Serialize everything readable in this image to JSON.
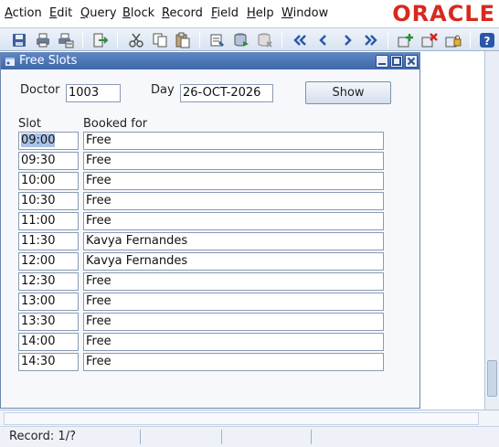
{
  "menu": {
    "items": [
      {
        "label": "Action",
        "mnemonic": "A",
        "rest": "ction"
      },
      {
        "label": "Edit",
        "mnemonic": "E",
        "rest": "dit"
      },
      {
        "label": "Query",
        "mnemonic": "Q",
        "rest": "uery"
      },
      {
        "label": "Block",
        "mnemonic": "B",
        "rest": "lock"
      },
      {
        "label": "Record",
        "mnemonic": "R",
        "rest": "ecord"
      },
      {
        "label": "Field",
        "mnemonic": "F",
        "rest": "ield"
      },
      {
        "label": "Help",
        "mnemonic": "H",
        "rest": "elp"
      },
      {
        "label": "Window",
        "mnemonic": "W",
        "rest": "indow"
      }
    ],
    "brand": "ORACLE",
    "brand_color": "#d7291e"
  },
  "toolbar": {
    "icons": [
      "save-icon",
      "print-icon",
      "print-setup-icon",
      "exit-icon",
      "cut-icon",
      "copy-icon",
      "paste-icon",
      "enter-query-icon",
      "execute-query-icon",
      "cancel-query-icon",
      "first-record-icon",
      "previous-record-icon",
      "next-record-icon",
      "last-record-icon",
      "insert-record-icon",
      "delete-record-icon",
      "lock-record-icon",
      "help-icon"
    ]
  },
  "window": {
    "title": "Free Slots",
    "title_color": "#4a74b6"
  },
  "form": {
    "doctor_label": "Doctor",
    "doctor_value": "1003",
    "day_label": "Day",
    "day_value": "26-OCT-2026",
    "show_label": "Show"
  },
  "table": {
    "headers": {
      "slot": "Slot",
      "booked_for": "Booked for"
    },
    "rows": [
      {
        "slot": "09:00",
        "booked_for": "Free"
      },
      {
        "slot": "09:30",
        "booked_for": "Free"
      },
      {
        "slot": "10:00",
        "booked_for": "Free"
      },
      {
        "slot": "10:30",
        "booked_for": "Free"
      },
      {
        "slot": "11:00",
        "booked_for": "Free"
      },
      {
        "slot": "11:30",
        "booked_for": "Kavya Fernandes"
      },
      {
        "slot": "12:00",
        "booked_for": "Kavya Fernandes"
      },
      {
        "slot": "12:30",
        "booked_for": "Free"
      },
      {
        "slot": "13:00",
        "booked_for": "Free"
      },
      {
        "slot": "13:30",
        "booked_for": "Free"
      },
      {
        "slot": "14:00",
        "booked_for": "Free"
      },
      {
        "slot": "14:30",
        "booked_for": "Free"
      }
    ]
  },
  "status": {
    "record": "Record: 1/?"
  }
}
